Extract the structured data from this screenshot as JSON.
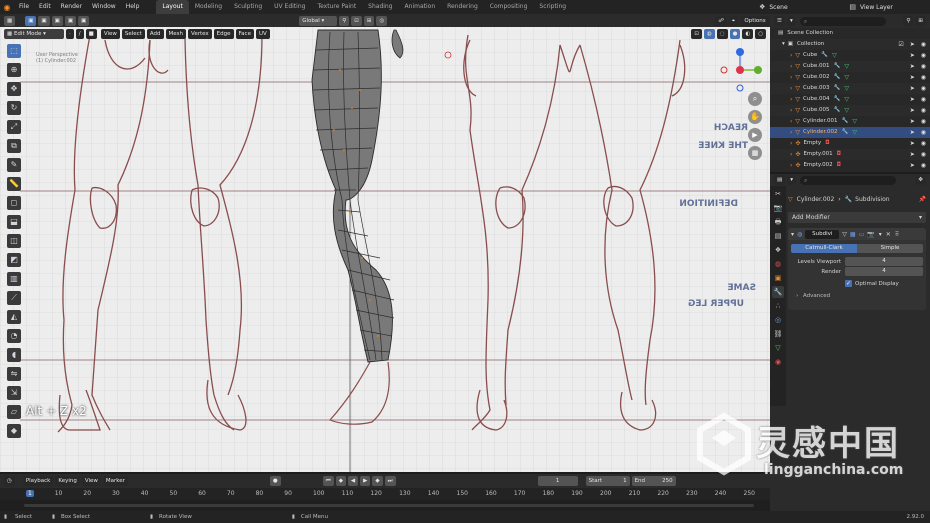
{
  "menu": [
    "File",
    "Edit",
    "Render",
    "Window",
    "Help"
  ],
  "workspaces": [
    "Layout",
    "Modeling",
    "Sculpting",
    "UV Editing",
    "Texture Paint",
    "Shading",
    "Animation",
    "Rendering",
    "Compositing",
    "Scripting"
  ],
  "active_workspace": "Layout",
  "scene": "Scene",
  "view_layer": "View Layer",
  "header": {
    "orientation": "Global",
    "options": "Options"
  },
  "edit_header": {
    "mode": "Edit Mode",
    "items": [
      "View",
      "Select",
      "Add",
      "Mesh",
      "Vertex",
      "Edge",
      "Face",
      "UV"
    ]
  },
  "viewport_overlay": {
    "key_hint": "Alt + Z x2"
  },
  "outliner": {
    "scene_collection": "Scene Collection",
    "collection": "Collection",
    "items": [
      {
        "name": "Cube",
        "selected": false
      },
      {
        "name": "Cube.001",
        "selected": false
      },
      {
        "name": "Cube.002",
        "selected": false
      },
      {
        "name": "Cube.003",
        "selected": false
      },
      {
        "name": "Cube.004",
        "selected": false
      },
      {
        "name": "Cube.005",
        "selected": false
      },
      {
        "name": "Cylinder.001",
        "selected": false
      },
      {
        "name": "Cylinder.002",
        "selected": true
      },
      {
        "name": "Empty",
        "selected": false
      },
      {
        "name": "Empty.001",
        "selected": false
      },
      {
        "name": "Empty.002",
        "selected": false
      }
    ]
  },
  "properties": {
    "object": "Cylinder.002",
    "modifier_name_header": "Subdivision",
    "add_modifier": "Add Modifier",
    "modifier_short": "Subdivi",
    "catmull": "Catmull-Clark",
    "simple": "Simple",
    "levels_viewport_label": "Levels Viewport",
    "levels_viewport": "4",
    "render_label": "Render",
    "render_value": "4",
    "optimal_display": "Optimal Display",
    "advanced": "Advanced"
  },
  "timeline": {
    "menu": [
      "Playback",
      "Keying",
      "View",
      "Marker"
    ],
    "current_frame": "1",
    "start_label": "Start",
    "start": "1",
    "end_label": "End",
    "end": "250",
    "ticks": [
      "1",
      "10",
      "20",
      "30",
      "40",
      "50",
      "60",
      "70",
      "80",
      "90",
      "100",
      "110",
      "120",
      "130",
      "140",
      "150",
      "160",
      "170",
      "180",
      "190",
      "200",
      "210",
      "220",
      "230",
      "240",
      "250"
    ]
  },
  "status": {
    "select": "Select",
    "box_select": "Box Select",
    "rotate": "Rotate View",
    "call_menu": "Call Menu",
    "version": "2.92.0"
  },
  "watermark": {
    "chinese": "灵感中国",
    "url": "lingganchina.com"
  },
  "colors": {
    "accent": "#4772b3",
    "selected_row": "#334d80",
    "orange": "#e68b2e",
    "green": "#3fd46c",
    "viewport_bg": "#ececec"
  }
}
